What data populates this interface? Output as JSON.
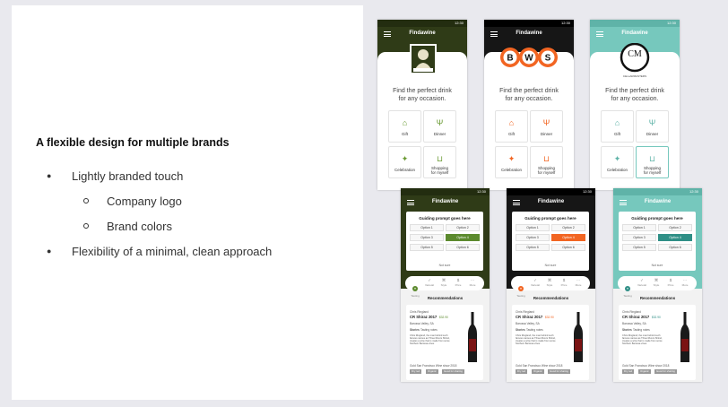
{
  "slide": {
    "heading": "A flexible design for multiple brands",
    "bullets": [
      {
        "text": "Lightly branded touch",
        "level": 1
      },
      {
        "text": "Company logo",
        "level": 2
      },
      {
        "text": "Brand colors",
        "level": 2
      },
      {
        "text": "Flexibility of a minimal, clean approach",
        "level": 1
      }
    ]
  },
  "app": {
    "title": "Findawine",
    "time": "12:30",
    "tagline_1": "Find the perfect drink",
    "tagline_2": "for any occasion.",
    "tiles": [
      {
        "icon": "gift-icon",
        "glyph": "⌂",
        "label": "Gift"
      },
      {
        "icon": "dinner-icon",
        "glyph": "Ψ",
        "label": "Dinner"
      },
      {
        "icon": "celebration-icon",
        "glyph": "✦",
        "label": "Celebration"
      },
      {
        "icon": "shopping-bag-icon",
        "glyph": "⊔",
        "label_1": "Shopping",
        "label_2": "for myself"
      }
    ],
    "prompt": {
      "title": "Guiding prompt goes here",
      "options": [
        "Option 1",
        "Option 2",
        "Option 3",
        "Option 4",
        "Option 5",
        "Option 6"
      ],
      "selected_index": 3,
      "not_sure": "Not sure"
    },
    "tabs": [
      "Tasting",
      "Varietal",
      "Style",
      "Price",
      "More"
    ],
    "recommendations": "Recommendations",
    "wine": {
      "producer": "Chris Ringland",
      "name": "CR Shiraz 2017",
      "price": "$32.90",
      "region": "Barossa Valley, SA",
      "tab_a": "Stories",
      "tab_b": "Tasting notes",
      "blurb_1": "Chris Ringland, the man behind such",
      "blurb_2": "famous names as Three Rivers Shiraz,",
      "blurb_3": "creates a wine that is made from some",
      "blurb_4": "Northern Barossa vines.",
      "award": "Gold San Francisco Wine show 2018",
      "tags": [
        "Dry red",
        "Organic",
        "Good for sharing"
      ]
    }
  },
  "brands": [
    {
      "name": "Dan Murphy's",
      "primary": "#2f3b17",
      "accent": "#5c8a2e"
    },
    {
      "name": "BWS",
      "primary": "#161616",
      "accent": "#f26522",
      "logo_letters": [
        "B",
        "W",
        "S"
      ]
    },
    {
      "name": "Cellarmasters",
      "primary": "#76c8bd",
      "accent": "#2f8f86",
      "logo_letters": "CM",
      "logo_caption": "CELLARMASTERS"
    }
  ]
}
